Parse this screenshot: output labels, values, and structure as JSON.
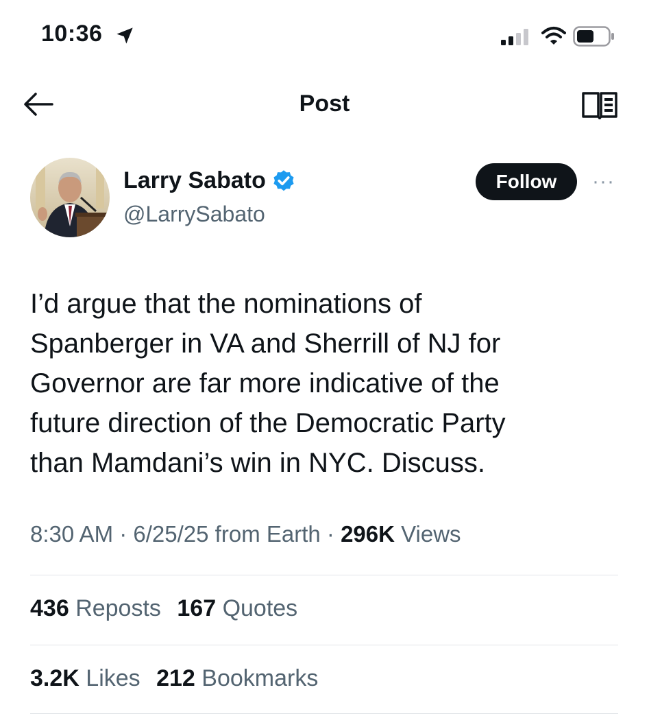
{
  "status_bar": {
    "time": "10:36"
  },
  "header": {
    "title": "Post",
    "back_icon": "arrow-left-icon",
    "reader_icon": "reader-mode-icon"
  },
  "author": {
    "name": "Larry Sabato",
    "handle": "@LarrySabato",
    "verified": true,
    "follow_label": "Follow",
    "more_label": "···"
  },
  "tweet": {
    "text": "I’d argue that the nominations of\nSpanberger in VA and Sherrill of NJ for\nGovernor are far more indicative of the\nfuture direction of the Democratic Party\nthan Mamdani’s win in NYC. Discuss."
  },
  "meta": {
    "time": "8:30 AM",
    "sep1": " · ",
    "date": "6/25/25",
    "source": " from Earth",
    "sep2": " · ",
    "views_count": "296K",
    "views_label": " Views"
  },
  "stats": {
    "reposts_count": "436",
    "reposts_label": "Reposts",
    "quotes_count": "167",
    "quotes_label": "Quotes",
    "likes_count": "3.2K",
    "likes_label": "Likes",
    "bookmarks_count": "212",
    "bookmarks_label": "Bookmarks"
  },
  "colors": {
    "text": "#0f1419",
    "secondary": "#536471",
    "verified": "#1d9bf0",
    "follow_bg": "#0f1419"
  }
}
